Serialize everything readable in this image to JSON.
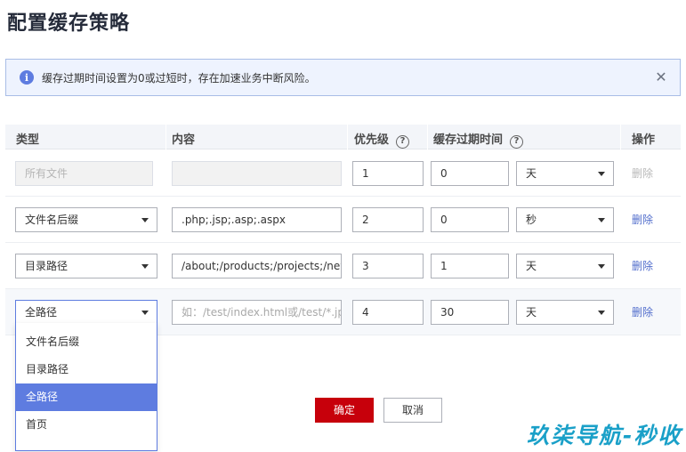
{
  "page": {
    "title": "配置缓存策略"
  },
  "alert": {
    "message": "缓存过期时间设置为0或过短时，存在加速业务中断风险。",
    "icon": "info-icon"
  },
  "table": {
    "headers": {
      "type": "类型",
      "content": "内容",
      "priority": "优先级",
      "expire": "缓存过期时间",
      "ops": "操作"
    },
    "rows": [
      {
        "type": "所有文件",
        "content": "",
        "priority": "1",
        "expire": "0",
        "unit": "天",
        "delete": "删除"
      },
      {
        "type": "文件名后缀",
        "content": ".php;.jsp;.asp;.aspx",
        "priority": "2",
        "expire": "0",
        "unit": "秒",
        "delete": "删除"
      },
      {
        "type": "目录路径",
        "content": "/about;/products;/projects;/news",
        "priority": "3",
        "expire": "1",
        "unit": "天",
        "delete": "删除"
      },
      {
        "type": "全路径",
        "content_placeholder": "如：/test/index.html或/test/*.jpg",
        "priority": "4",
        "expire": "30",
        "unit": "天",
        "delete": "删除"
      }
    ]
  },
  "dropdown": {
    "options": [
      "文件名后缀",
      "目录路径",
      "全路径",
      "首页"
    ],
    "selected": "全路径"
  },
  "buttons": {
    "confirm": "确定",
    "cancel": "取消"
  },
  "watermark": "玖柒导航-秒收"
}
